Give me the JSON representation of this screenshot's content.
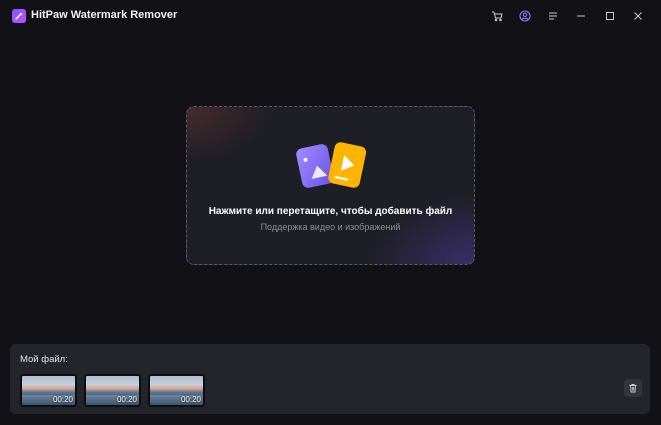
{
  "app": {
    "title": "HitPaw Watermark Remover",
    "logo_icon": "sparkle-wand-icon",
    "accent_color": "#7b5cff"
  },
  "titlebar": {
    "buttons": [
      {
        "name": "cart-button",
        "icon": "cart-icon"
      },
      {
        "name": "account-button",
        "icon": "user-circle-icon"
      },
      {
        "name": "menu-button",
        "icon": "menu-icon"
      },
      {
        "name": "minimize-button",
        "icon": "minimize-icon"
      },
      {
        "name": "maximize-button",
        "icon": "maximize-icon"
      },
      {
        "name": "close-button",
        "icon": "close-icon"
      }
    ]
  },
  "dropzone": {
    "title": "Нажмите или перетащите, чтобы добавить файл",
    "subtitle": "Поддержка видео и изображений",
    "icon": "video-image-files-icon"
  },
  "files": {
    "label": "Мой файл:",
    "items": [
      {
        "duration": "00:20"
      },
      {
        "duration": "00:20"
      },
      {
        "duration": "00:20"
      }
    ],
    "delete_icon": "trash-icon"
  }
}
